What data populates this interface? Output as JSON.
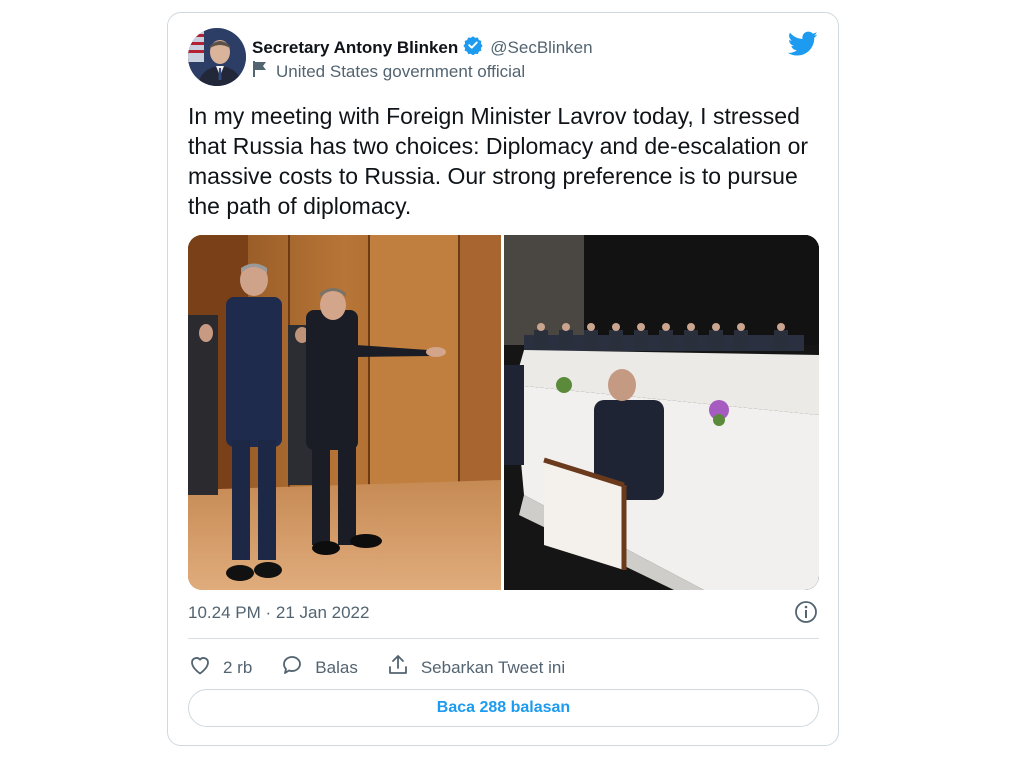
{
  "author": {
    "display_name": "Secretary Antony Blinken",
    "handle": "@SecBlinken",
    "label": "United States government official",
    "verified_icon": "verified-badge-icon",
    "label_icon": "flag-icon"
  },
  "tweet": {
    "text": "In my meeting with Foreign Minister Lavrov today, I stressed that Russia has two choices: Diplomacy and de-escalation or massive costs to Russia. Our strong preference is to pursue the path of diplomacy.",
    "timestamp": "10.24 PM · 21 Jan 2022"
  },
  "actions": {
    "like_count": "2 rb",
    "reply_label": "Balas",
    "share_label": "Sebarkan Tweet ini"
  },
  "read_replies_label": "Baca 288 balasan",
  "colors": {
    "accent": "#1d9bf0",
    "text": "#0f1419",
    "secondary": "#536471",
    "border": "#cfd9de"
  },
  "icons": {
    "brand": "twitter-bird-icon",
    "info": "info-icon",
    "like": "heart-icon",
    "reply": "speech-bubble-icon",
    "share": "share-icon"
  }
}
